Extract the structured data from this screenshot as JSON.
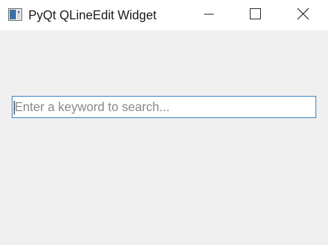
{
  "window": {
    "title": "PyQt QLineEdit Widget",
    "icon": "python-app-icon",
    "buttons": {
      "minimize": "minimize-icon",
      "maximize": "maximize-icon",
      "close": "close-icon"
    }
  },
  "search": {
    "value": "",
    "placeholder": "Enter a keyword to search..."
  },
  "colors": {
    "focus_border": "#2c7bc0",
    "window_bg": "#f0f0f0",
    "titlebar_bg": "#ffffff"
  }
}
